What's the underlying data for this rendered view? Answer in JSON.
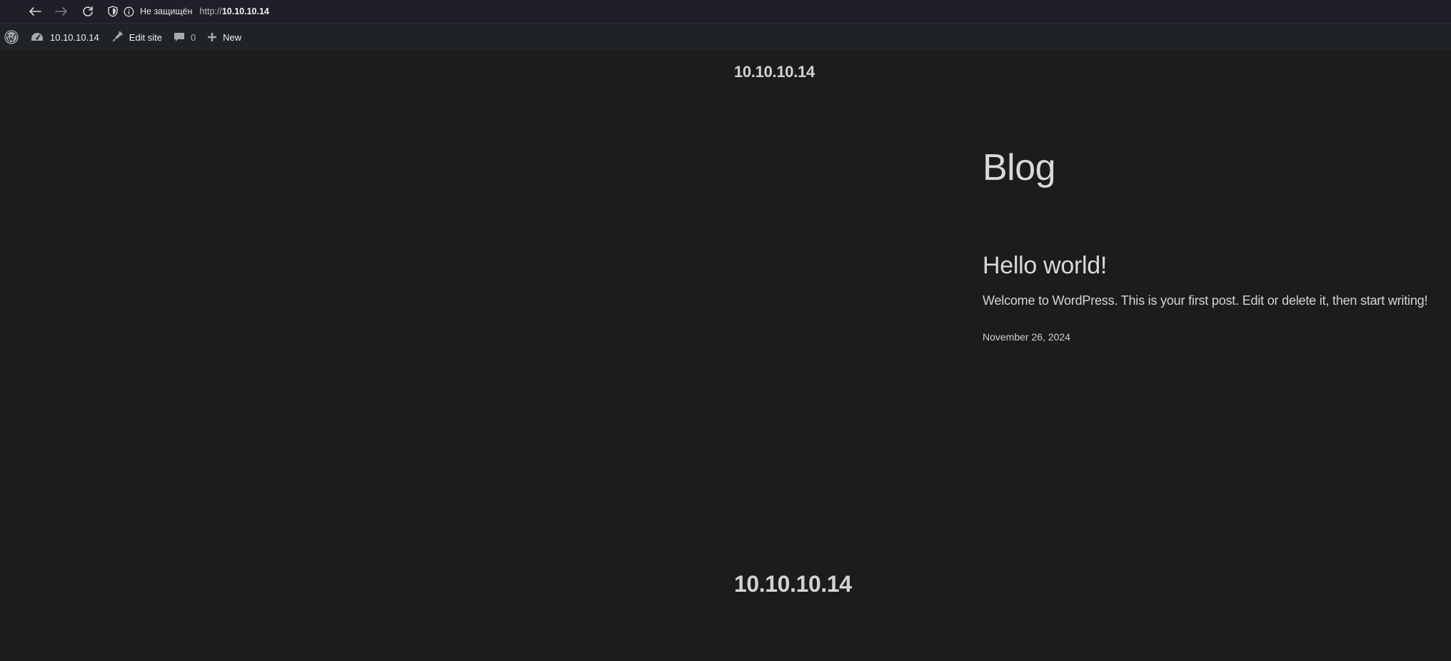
{
  "browser": {
    "security_label": "Не защищён",
    "url_protocol": "http://",
    "url_host": "10.10.10.14",
    "icons": [
      "back-arrow-icon",
      "forward-arrow-icon",
      "reload-icon",
      "shield-icon",
      "info-icon"
    ]
  },
  "admin_bar": {
    "site_name": "10.10.10.14",
    "edit_site_label": "Edit site",
    "comments_count": "0",
    "new_label": "New",
    "icons": [
      "wordpress-logo-icon",
      "dashboard-icon",
      "brush-icon",
      "comment-icon",
      "plus-icon"
    ]
  },
  "header": {
    "site_title": "10.10.10.14"
  },
  "main": {
    "page_title": "Blog",
    "posts": [
      {
        "title": "Hello world!",
        "excerpt": "Welcome to WordPress. This is your first post. Edit or delete it, then start writing!",
        "date": "November 26, 2024"
      }
    ]
  },
  "footer": {
    "site_title": "10.10.10.14"
  },
  "colors": {
    "page_bg": "#1c1c1c",
    "admin_bar_bg": "#1d2327",
    "browser_bar_bg": "#1f1f27",
    "text": "#d6d6d6"
  }
}
